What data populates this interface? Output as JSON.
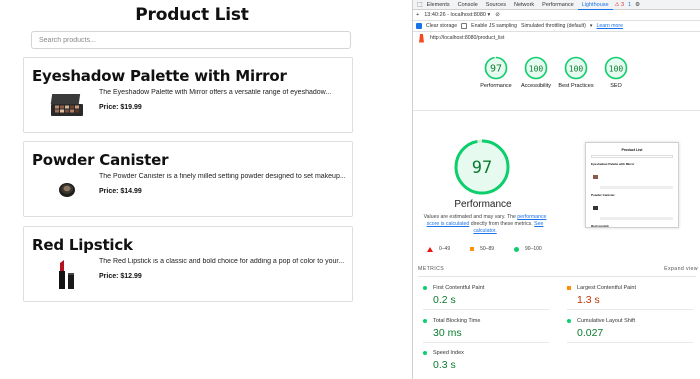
{
  "app": {
    "title": "Product List",
    "search_placeholder": "Search products...",
    "products": [
      {
        "name": "Eyeshadow Palette with Mirror",
        "description": "The Eyeshadow Palette with Mirror offers a versatile range of eyeshadow...",
        "price": "Price: $19.99",
        "image": "eyeshadow-palette"
      },
      {
        "name": "Powder Canister",
        "description": "The Powder Canister is a finely milled setting powder designed to set makeup...",
        "price": "Price: $14.99",
        "image": "powder-canister"
      },
      {
        "name": "Red Lipstick",
        "description": "The Red Lipstick is a classic and bold choice for adding a pop of color to your...",
        "price": "Price: $12.99",
        "image": "red-lipstick"
      }
    ]
  },
  "devtools": {
    "tabs": [
      "Elements",
      "Console",
      "Sources",
      "Network",
      "Performance",
      "Lighthouse"
    ],
    "active_tab": "Lighthouse",
    "warning_count": "⚠ 3",
    "info_count": "1",
    "report_select": "13:40:26 - localhost:8080",
    "clear_storage": "Clear storage",
    "js_sampling": "Enable JS sampling",
    "throttling": "Simulated throttling (default)",
    "learn_more": "Learn more",
    "url": "http://localhost:8080/product_list",
    "gauges": [
      {
        "label": "Performance",
        "score": "97"
      },
      {
        "label": "Accessibility",
        "score": "100"
      },
      {
        "label": "Best Practices",
        "score": "100"
      },
      {
        "label": "SEO",
        "score": "100"
      }
    ],
    "performance": {
      "score": "97",
      "title": "Performance",
      "note_1": "Values are estimated and may vary. The ",
      "note_link_1": "performance score is calculated",
      "note_2": " directly from these metrics. ",
      "note_link_2": "See calculator.",
      "legend": [
        "0–49",
        "50–89",
        "90–100"
      ]
    },
    "thumbnail": {
      "title": "Product List",
      "items": [
        "Eyeshadow Palette with Mirror",
        "Powder Canister",
        "Red Lipstick"
      ]
    },
    "metrics_label": "METRICS",
    "expand_view": "Expand view",
    "metrics": [
      {
        "name": "First Contentful Paint",
        "value": "0.2 s",
        "status": "good"
      },
      {
        "name": "Largest Contentful Paint",
        "value": "1.3 s",
        "status": "average"
      },
      {
        "name": "Total Blocking Time",
        "value": "30 ms",
        "status": "good"
      },
      {
        "name": "Cumulative Layout Shift",
        "value": "0.027",
        "status": "good"
      },
      {
        "name": "Speed Index",
        "value": "0.3 s",
        "status": "good"
      }
    ],
    "colors": {
      "good": "#0cce6b",
      "average": "#fa8f0d",
      "poor": "#e8190a",
      "accent": "#1a73e8"
    }
  }
}
